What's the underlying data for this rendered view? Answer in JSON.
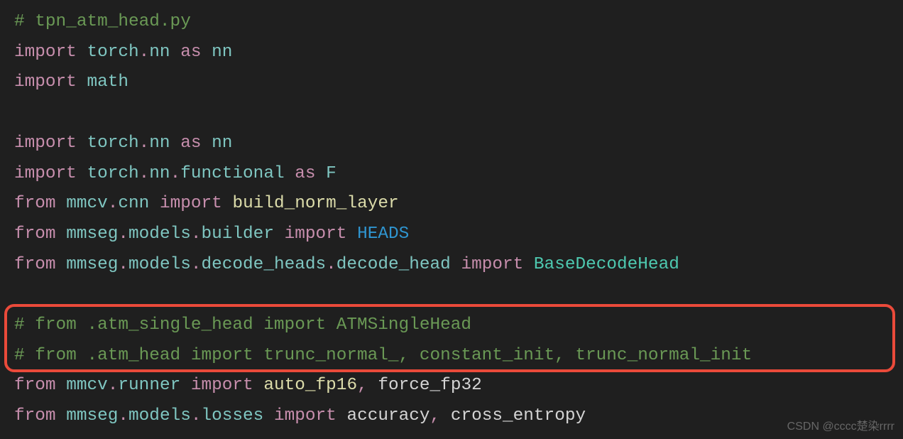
{
  "lines": {
    "l1_comment": "# tpn_atm_head.py",
    "l2": {
      "kw1": "import",
      "m1": "torch",
      "dot1": ".",
      "m2": "nn",
      "kw2": "as",
      "a": "nn"
    },
    "l3": {
      "kw1": "import",
      "m1": "math"
    },
    "l5": {
      "kw1": "import",
      "m1": "torch",
      "dot1": ".",
      "m2": "nn",
      "kw2": "as",
      "a": "nn"
    },
    "l6": {
      "kw1": "import",
      "m1": "torch",
      "dot1": ".",
      "m2": "nn",
      "dot2": ".",
      "m3": "functional",
      "kw2": "as",
      "a": "F"
    },
    "l7": {
      "kw1": "from",
      "m1": "mmcv",
      "dot1": ".",
      "m2": "cnn",
      "kw2": "import",
      "f": "build_norm_layer"
    },
    "l8": {
      "kw1": "from",
      "m1": "mmseg",
      "dot1": ".",
      "m2": "models",
      "dot2": ".",
      "m3": "builder",
      "kw2": "import",
      "c": "HEADS"
    },
    "l9": {
      "kw1": "from",
      "m1": "mmseg",
      "dot1": ".",
      "m2": "models",
      "dot2": ".",
      "m3": "decode_heads",
      "dot3": ".",
      "m4": "decode_head",
      "kw2": "import",
      "c": "BaseDecodeHead"
    },
    "l11_comment": "# from .atm_single_head import ATMSingleHead",
    "l12_comment": "# from .atm_head import trunc_normal_, constant_init, trunc_normal_init",
    "l13": {
      "kw1": "from",
      "m1": "mmcv",
      "dot1": ".",
      "m2": "runner",
      "kw2": "import",
      "f1": "auto_fp16",
      "comma": ",",
      "f2": "force_fp32"
    },
    "l14": {
      "kw1": "from",
      "m1": "mmseg",
      "dot1": ".",
      "m2": "models",
      "dot2": ".",
      "m3": "losses",
      "kw2": "import",
      "f1": "accuracy",
      "comma": ",",
      "f2": "cross_entropy"
    }
  },
  "watermark": "CSDN @cccc楚染rrrr"
}
